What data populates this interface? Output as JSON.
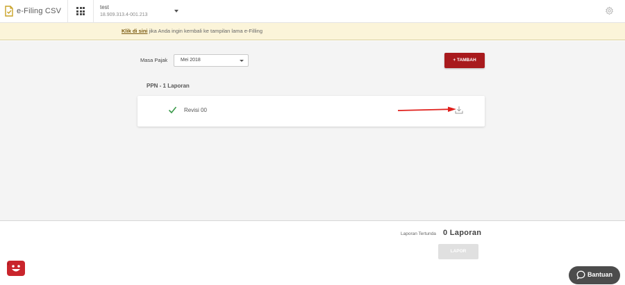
{
  "topbar": {
    "app_title": "e-Filing CSV",
    "account_name": "test",
    "account_npwp": "18.909.313.4-001.213"
  },
  "notice": {
    "link_text": "Klik di sini",
    "message": " jika Anda ingin kembali ke tampilan lama e-Filling"
  },
  "filter": {
    "label": "Masa Pajak",
    "selected": "Mei 2018"
  },
  "toolbar": {
    "add_label": "+ TAMBAH"
  },
  "section": {
    "title": "PPN - 1 Laporan"
  },
  "reports": [
    {
      "label": "Revisi 00",
      "status": "success"
    }
  ],
  "footer": {
    "pending_label": "Laporan Tertunda",
    "pending_value": "0 Laporan",
    "submit_label": "LAPOR"
  },
  "help": {
    "label": "Bantuan"
  },
  "colors": {
    "accent_red": "#a81a1d",
    "notice_bg": "#fbf4d9",
    "check_green": "#3a9a4a",
    "annotation_red": "#e0201c",
    "logo_gold": "#c9a227"
  }
}
